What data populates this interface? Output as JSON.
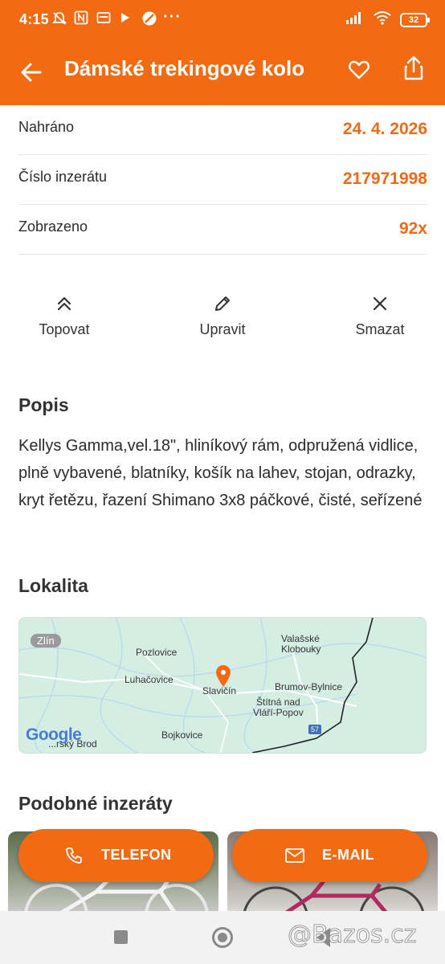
{
  "status_bar": {
    "time": "4:15",
    "overflow": "···",
    "battery": "32",
    "icons": [
      "muted-bell-icon",
      "nfc-icon",
      "wallet-icon",
      "play-icon",
      "vpn-icon",
      "signal-icon",
      "wifi-icon",
      "battery-icon"
    ]
  },
  "header": {
    "title": "Dámské trekingové kolo",
    "back_icon": "arrow-left-icon",
    "favorite_icon": "heart-icon",
    "share_icon": "share-icon"
  },
  "info": [
    {
      "label": "Nahráno",
      "value": "24. 4. 2026"
    },
    {
      "label": "Číslo inzerátu",
      "value": "217971998"
    },
    {
      "label": "Zobrazeno",
      "value": "92x"
    }
  ],
  "actions": {
    "top": "Topovat",
    "edit": "Upravit",
    "delete": "Smazat"
  },
  "description": {
    "heading": "Popis",
    "text": "Kellys Gamma,vel.18\", hliníkový rám, odpružená vidlice, plně vybavené, blatníky, košík na lahev, stojan, odrazky, kryt řetězu, řazení Shimano 3x8 páčkové, čisté, seřízené"
  },
  "location": {
    "heading": "Lokalita",
    "map": {
      "badge": "Zlín",
      "places": [
        "Pozlovice",
        "Luhačovice",
        "Slavičín",
        "Valašské",
        "Klobouky",
        "Brumov-Bylnice",
        "Štítná nad",
        "Vláří-Popov",
        "Bojkovice",
        "...rský Brod"
      ],
      "road": "57",
      "logo": "Google"
    }
  },
  "similar": {
    "heading": "Podobné inzeráty"
  },
  "cta": {
    "phone": "TELEFON",
    "email": "E-MAIL"
  },
  "watermark": "@Bazos.cz",
  "colors": {
    "accent": "#f26b12",
    "value": "#ee6a17"
  }
}
